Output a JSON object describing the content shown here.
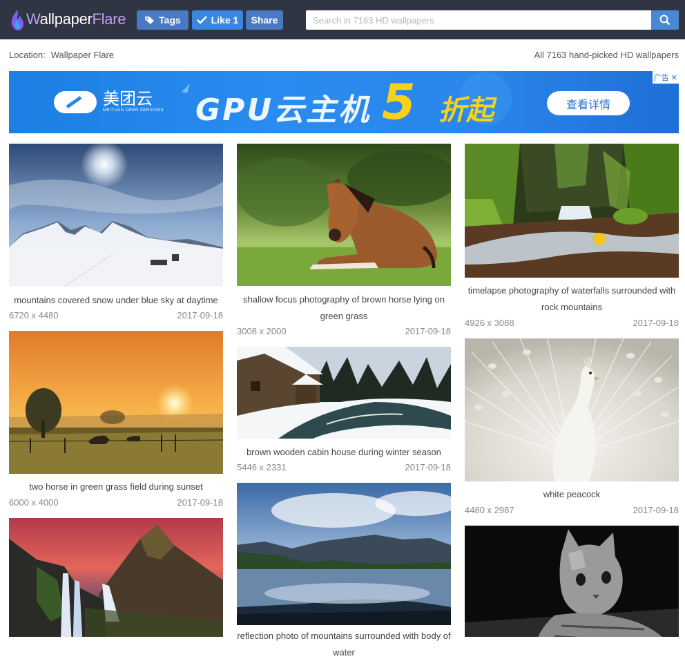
{
  "header": {
    "logo_text_a": "W",
    "logo_text_b": "allpaper",
    "logo_text_c": "Flare",
    "tags_label": "Tags",
    "like_label": "Like 1",
    "share_label": "Share",
    "search_placeholder": "Search in 7163 HD wallpapers",
    "icons": [
      "tag-icon",
      "check-icon",
      "search-icon"
    ]
  },
  "location": {
    "label": "Location:",
    "value": "Wallpaper Flare"
  },
  "total_text": "All 7163 hand-picked HD wallpapers",
  "ad": {
    "brand": "美团云",
    "brand_sub": "MEITUAN OPEN SERVICES",
    "headline": "GPU云主机",
    "five": "5",
    "discount_suffix": "折起",
    "cta": "查看详情",
    "tag": "广告",
    "close": "✕"
  },
  "wallpapers": [
    {
      "title": "mountains covered snow under blue sky at daytime",
      "dims": "6720 x 4480",
      "date": "2017-09-18"
    },
    {
      "title": "shallow focus photography of brown horse lying on green grass",
      "dims": "3008 x 2000",
      "date": "2017-09-18"
    },
    {
      "title": "timelapse photography of waterfalls surrounded with rock mountains",
      "dims": "4926 x 3088",
      "date": "2017-09-18"
    },
    {
      "title": "two horse in green grass field during sunset",
      "dims": "6000 x 4000",
      "date": "2017-09-18"
    },
    {
      "title": "brown wooden cabin house during winter season",
      "dims": "5446 x 2331",
      "date": "2017-09-18"
    },
    {
      "title": "white peacock",
      "dims": "4480 x 2987",
      "date": "2017-09-18"
    },
    {
      "title": "",
      "dims": "",
      "date": ""
    },
    {
      "title": "reflection photo of mountains surrounded with body of water",
      "dims": "",
      "date": ""
    },
    {
      "title": "",
      "dims": "",
      "date": ""
    }
  ]
}
